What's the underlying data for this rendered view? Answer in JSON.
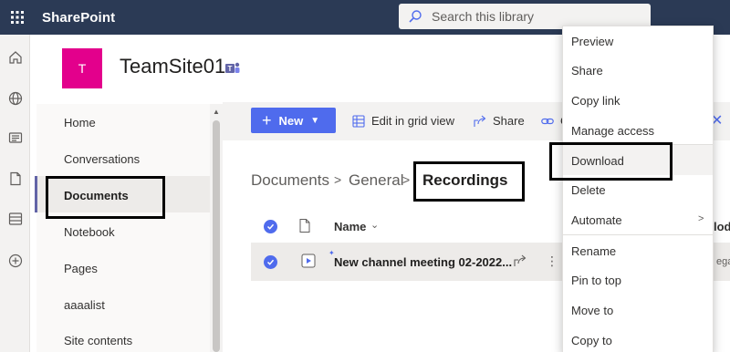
{
  "topbar": {
    "app_name": "SharePoint",
    "search_placeholder": "Search this library"
  },
  "site": {
    "logo_letter": "T",
    "title": "TeamSite01"
  },
  "leftnav": {
    "items": [
      {
        "label": "Home"
      },
      {
        "label": "Conversations"
      },
      {
        "label": "Documents",
        "selected": true
      },
      {
        "label": "Notebook"
      },
      {
        "label": "Pages"
      },
      {
        "label": "aaaalist"
      },
      {
        "label": "Site contents"
      }
    ]
  },
  "commandbar": {
    "new_label": "New",
    "edit_grid_label": "Edit in grid view",
    "share_label": "Share",
    "link_label": "C"
  },
  "breadcrumb": {
    "items": [
      "Documents",
      "General"
    ],
    "current": "Recordings"
  },
  "list": {
    "col_name": "Name",
    "col_modified_partial": "lod",
    "rows": [
      {
        "name": "New channel meeting 02-2022...",
        "modified_partial": "ega"
      }
    ]
  },
  "context_menu": {
    "items": [
      "Preview",
      "Share",
      "Copy link",
      "Manage access",
      "Download",
      "Delete",
      "Automate",
      "Rename",
      "Pin to top",
      "Move to",
      "Copy to"
    ],
    "highlighted": "Download"
  },
  "colors": {
    "topbar": "#2b3a55",
    "accent": "#4f6bed",
    "site_logo": "#e3008c"
  }
}
